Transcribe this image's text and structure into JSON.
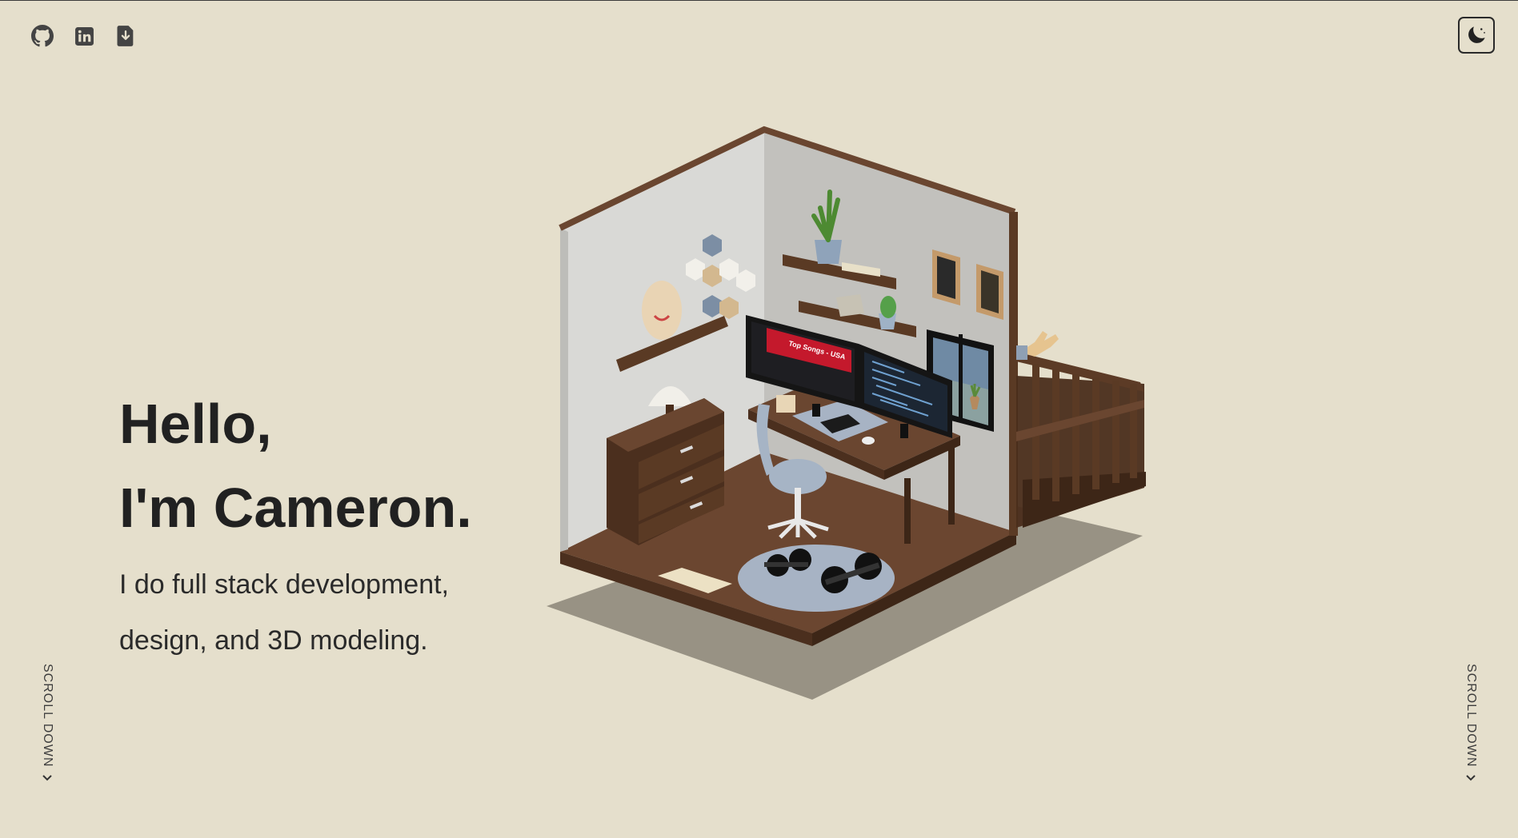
{
  "social": {
    "github": {
      "icon": "github-icon"
    },
    "linkedin": {
      "icon": "linkedin-icon"
    },
    "resume": {
      "icon": "document-download-icon"
    }
  },
  "theme_toggle": {
    "icon": "moon-icon"
  },
  "hero": {
    "line1": "Hello,",
    "line2": "I'm Cameron.",
    "tagline1": "I do full stack development,",
    "tagline2": "design, and 3D modeling."
  },
  "scroll": {
    "left_label": "SCROLL DOWN",
    "right_label": "SCROLL DOWN"
  },
  "scene": {
    "monitor_text": "Top Songs - USA"
  },
  "colors": {
    "background": "#e5dfcc",
    "text": "#212121",
    "wood": "#5a3a24",
    "wall": "#c9c8c3"
  }
}
